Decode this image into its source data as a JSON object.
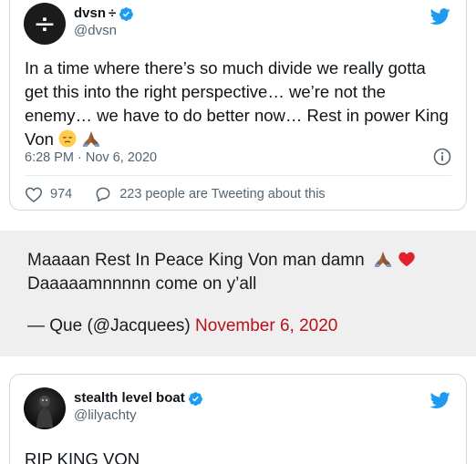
{
  "tweet1": {
    "display_name": "dvsn",
    "name_suffix": "÷",
    "handle": "@dvsn",
    "avatar_glyph": "÷",
    "text_main": "In a time where there’s so much divide we really gotta get this into the right perspective… we’re not the enemy… we have to do better now… Rest in power King Von",
    "timestamp": "6:28 PM · Nov 6, 2020",
    "likes": "974",
    "replies_text": "223 people are Tweeting about this",
    "emojis": [
      "pensive-face",
      "folded-hands-medium-dark"
    ]
  },
  "quote": {
    "line1": "Maaaan Rest In Peace King Von man damn",
    "line2": "Daaaaamnnnnn come on y’all",
    "attribution": "— Que (@Jacquees)",
    "date": "November 6, 2020",
    "emojis": [
      "folded-hands-medium-dark",
      "red-heart"
    ]
  },
  "tweet3": {
    "display_name": "stealth level boat",
    "handle": "@lilyachty",
    "text": "RIP KING VON"
  },
  "colors": {
    "twitter_blue": "#1d9bf0",
    "date_red": "#b5121b",
    "muted_gray": "#536471",
    "quote_bg": "#efefef"
  }
}
